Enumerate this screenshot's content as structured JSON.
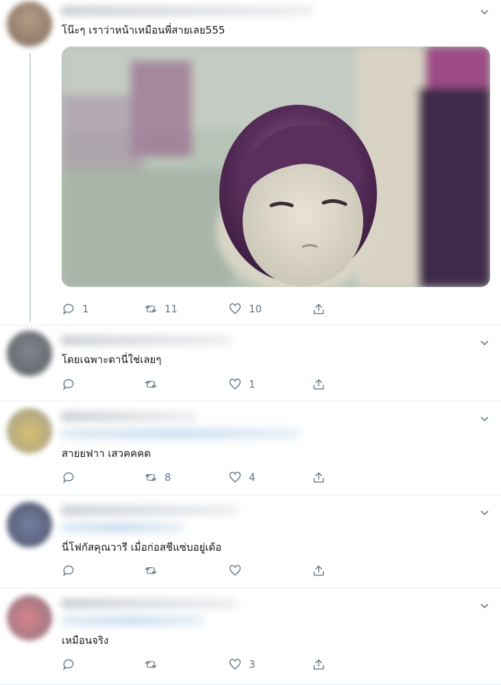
{
  "tweets": [
    {
      "text": "โน๊ะๆ เราว่าหน้าเหมือนพี่สายเลย555",
      "counts": {
        "reply": "1",
        "retweet": "11",
        "like": "10"
      },
      "has_media": true,
      "avatar_color": "#8a6e58"
    },
    {
      "text": "โดยเฉพาะตานี่ใช่เลยๆ",
      "counts": {
        "reply": "",
        "retweet": "",
        "like": "1"
      },
      "avatar_color": "#5a5e66"
    },
    {
      "text": "สายยฟาา เสวคคคด",
      "counts": {
        "reply": "",
        "retweet": "8",
        "like": "4"
      },
      "avatar_color": "#b8a66a"
    },
    {
      "text": "นี่โฟกัสคุณวารี เมื่อก่อสชีแซ่บอยู่เด้อ",
      "counts": {
        "reply": "",
        "retweet": "",
        "like": ""
      },
      "avatar_color": "#4e5a78"
    },
    {
      "text": "เหมือนจริง",
      "counts": {
        "reply": "",
        "retweet": "",
        "like": "3"
      },
      "avatar_color": "#b06a70"
    }
  ],
  "icons": {
    "reply": "reply-icon",
    "retweet": "retweet-icon",
    "like": "like-icon",
    "share": "share-icon",
    "menu": "chevron-down-icon"
  },
  "colors": {
    "icon": "#657786",
    "divider": "#e6ecf0",
    "thread_line": "#ccd6dd"
  }
}
